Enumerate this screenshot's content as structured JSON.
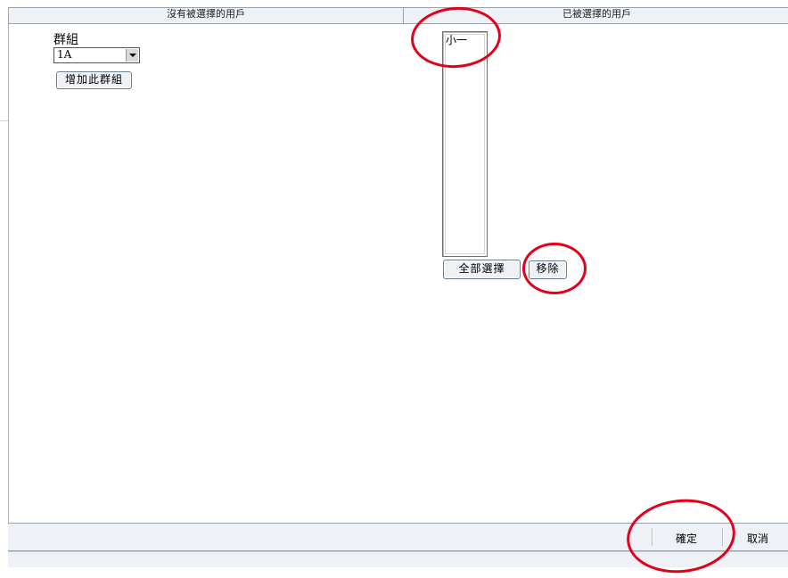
{
  "header": {
    "left_title": "沒有被選擇的用戶",
    "right_title": "已被選擇的用戶"
  },
  "left_panel": {
    "group_label": "群組",
    "group_select_value": "1A",
    "add_group_button": "增加此群組"
  },
  "right_panel": {
    "selected_users": [
      "小一"
    ],
    "select_all_button": "全部選擇",
    "remove_button": "移除"
  },
  "footer": {
    "ok_label": "確定",
    "cancel_label": "取消"
  },
  "colors": {
    "bar_background": "#eef1f5",
    "annotation": "#e3001b"
  }
}
